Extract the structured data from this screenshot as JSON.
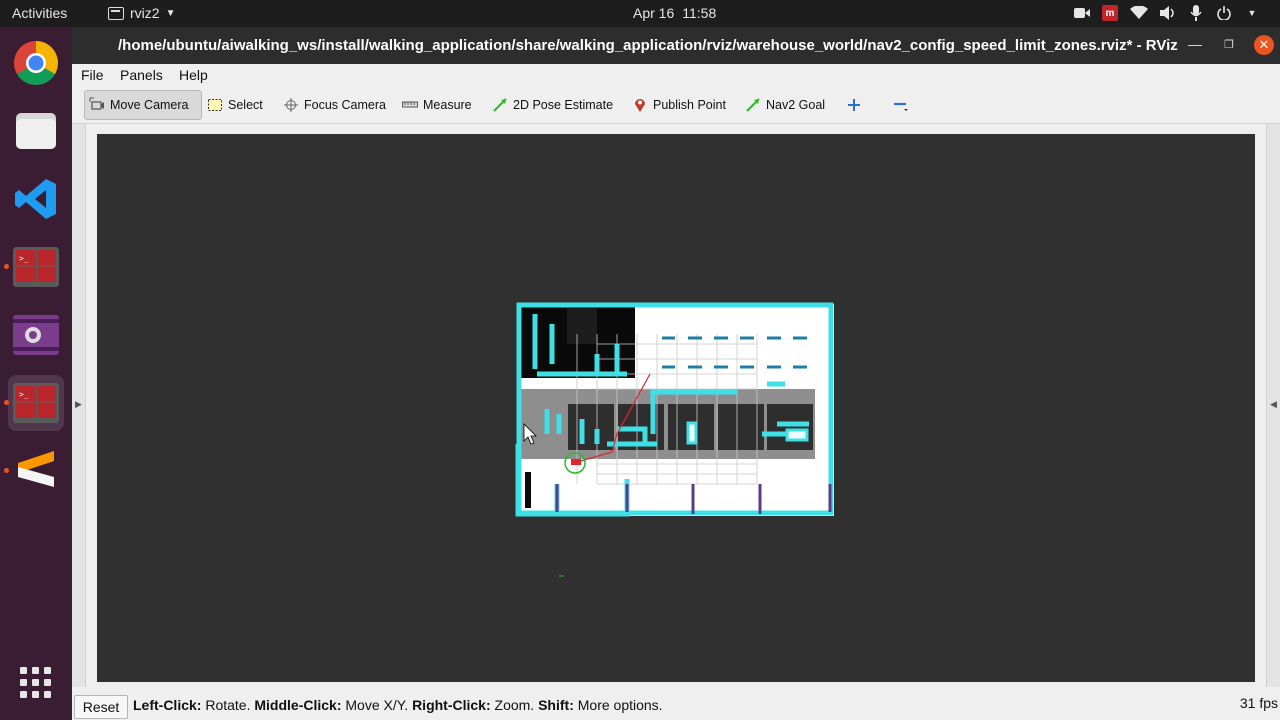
{
  "topbar": {
    "activities": "Activities",
    "app_name": "rviz2",
    "date": "Apr 16",
    "time": "11:58",
    "tray_icons": [
      "camera-icon",
      "record-icon",
      "wifi-icon",
      "volume-icon",
      "microphone-icon",
      "power-icon"
    ]
  },
  "dock": {
    "items": [
      {
        "name": "chrome",
        "icon": "chrome-icon"
      },
      {
        "name": "files",
        "icon": "files-icon"
      },
      {
        "name": "vscode",
        "icon": "vscode-icon"
      },
      {
        "name": "terminal",
        "icon": "terminal-icon"
      },
      {
        "name": "video-recorder",
        "icon": "video-icon"
      },
      {
        "name": "terminal-2",
        "icon": "terminal-icon"
      },
      {
        "name": "sublime",
        "icon": "sublime-icon"
      },
      {
        "name": "app-grid",
        "icon": "app-grid-icon"
      }
    ]
  },
  "window": {
    "title": "/home/ubuntu/aiwalking_ws/install/walking_application/share/walking_application/rviz/warehouse_world/nav2_config_speed_limit_zones.rviz* - RViz",
    "menu": [
      "File",
      "Panels",
      "Help"
    ],
    "tools": [
      {
        "label": "Move Camera",
        "icon": "move-camera-icon"
      },
      {
        "label": "Select",
        "icon": "select-icon"
      },
      {
        "label": "Focus Camera",
        "icon": "focus-camera-icon"
      },
      {
        "label": "Measure",
        "icon": "measure-icon"
      },
      {
        "label": "2D Pose Estimate",
        "icon": "pose-estimate-icon"
      },
      {
        "label": "Publish Point",
        "icon": "publish-point-icon"
      },
      {
        "label": "Nav2 Goal",
        "icon": "nav2-goal-icon"
      }
    ],
    "status": {
      "reset": "Reset",
      "left_click_key": "Left-Click:",
      "left_click_val": "Rotate.",
      "middle_click_key": "Middle-Click:",
      "middle_click_val": "Move X/Y.",
      "right_click_key": "Right-Click:",
      "right_click_val": "Zoom.",
      "shift_key": "Shift:",
      "shift_val": "More options.",
      "fps": "31 fps"
    }
  },
  "colors": {
    "costmap_cyan": "#3ee0e6",
    "map_free": "#ffffff",
    "map_obstacle": "#0a0a0a",
    "map_grey": "#8a8a8a",
    "viewport_bg": "#303030",
    "accent": "#e95420",
    "dock_bg": "#3a1c33"
  }
}
